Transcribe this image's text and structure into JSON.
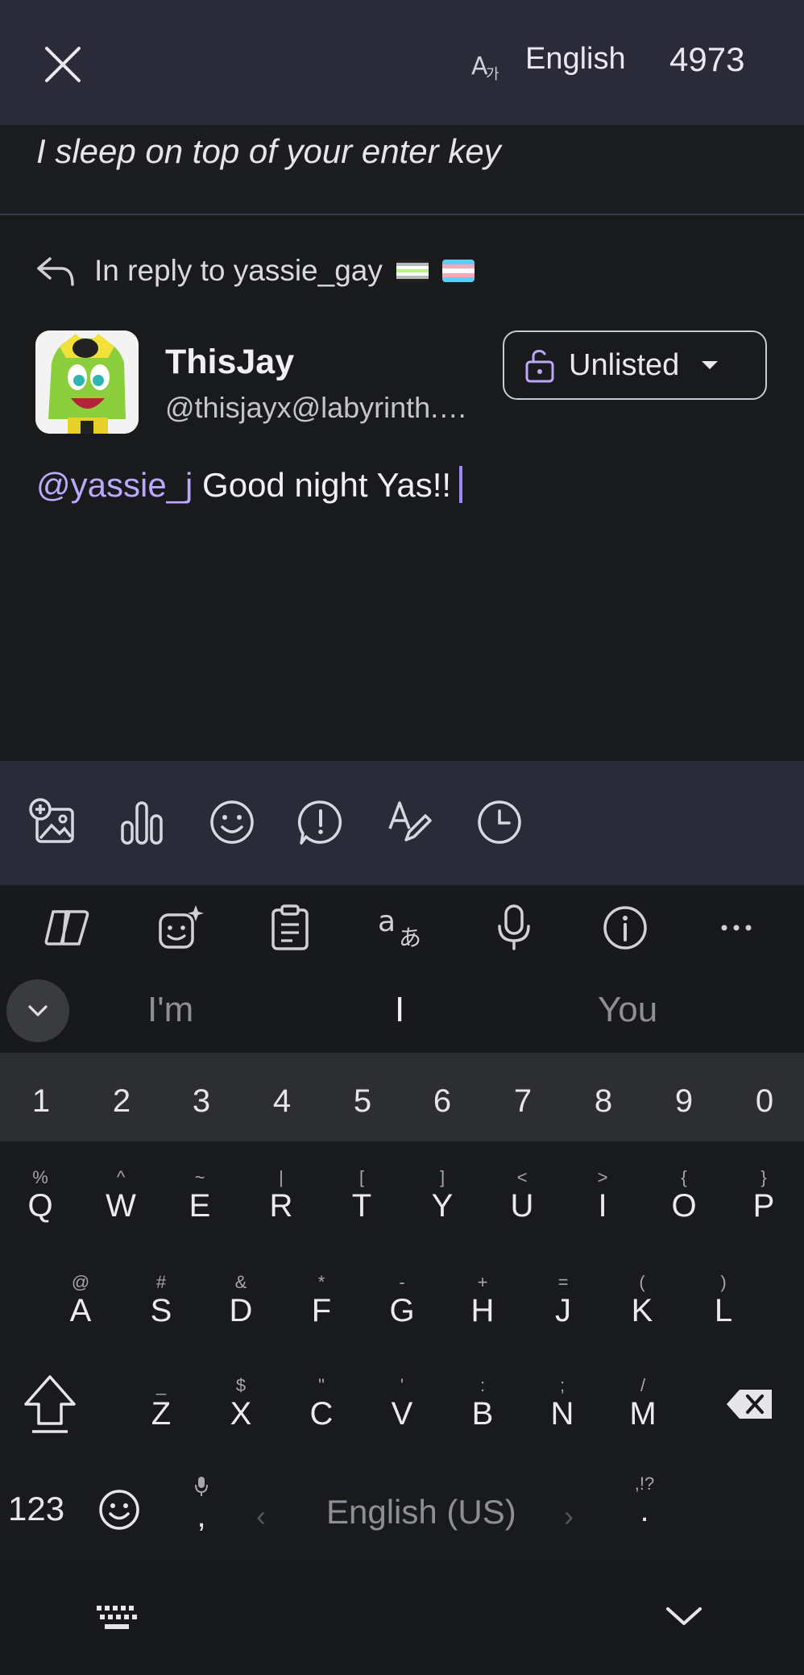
{
  "topbar": {
    "language": "English",
    "char_remaining": "4973",
    "icons": {
      "close": "close-icon",
      "language": "translate-icon"
    }
  },
  "content_warning": "I sleep on top of your enter key",
  "reply": {
    "label": "In reply to yassie_gay",
    "icon": "reply-arrow-icon"
  },
  "account": {
    "display_name": "ThisJay",
    "handle": "@thisjayx@labyrinth.zone"
  },
  "visibility": {
    "label": "Unlisted",
    "icon": "unlock-icon"
  },
  "post": {
    "mention": "@yassie_j",
    "text": " Good night Yas!!"
  },
  "compose_tools": [
    "add-media-icon",
    "poll-icon",
    "emoji-icon",
    "content-warning-icon",
    "formatting-icon",
    "schedule-icon"
  ],
  "keyboard": {
    "tools": [
      "copilot-icon",
      "sticker-icon",
      "clipboard-icon",
      "translate-icon",
      "microphone-icon",
      "info-icon",
      "more-icon"
    ],
    "suggestions": [
      "I'm",
      "I",
      "You"
    ],
    "numbers": [
      "1",
      "2",
      "3",
      "4",
      "5",
      "6",
      "7",
      "8",
      "9",
      "0"
    ],
    "row1": [
      [
        "%",
        "Q"
      ],
      [
        "^",
        "W"
      ],
      [
        "~",
        "E"
      ],
      [
        "|",
        "R"
      ],
      [
        "[",
        "T"
      ],
      [
        "]",
        "Y"
      ],
      [
        "<",
        "U"
      ],
      [
        ">",
        "I"
      ],
      [
        "{",
        "O"
      ],
      [
        "}",
        "P"
      ]
    ],
    "row2": [
      [
        "@",
        "A"
      ],
      [
        "#",
        "S"
      ],
      [
        "&",
        "D"
      ],
      [
        "*",
        "F"
      ],
      [
        "-",
        "G"
      ],
      [
        "+",
        "H"
      ],
      [
        "=",
        "J"
      ],
      [
        "(",
        "K"
      ],
      [
        ")",
        "L"
      ]
    ],
    "row3": [
      [
        "_",
        "Z"
      ],
      [
        "$",
        "X"
      ],
      [
        "\"",
        "C"
      ],
      [
        "'",
        "V"
      ],
      [
        ":",
        "B"
      ],
      [
        ";",
        "N"
      ],
      [
        "/",
        "M"
      ]
    ],
    "symbols_key": "123",
    "comma": ",",
    "space_label": "English (US)",
    "period_sub": ",!?",
    "period": "."
  },
  "colors": {
    "bar": "#2a2a38",
    "background": "#181a1c",
    "accent": "#bda7ff",
    "caret": "#9f86ff"
  }
}
